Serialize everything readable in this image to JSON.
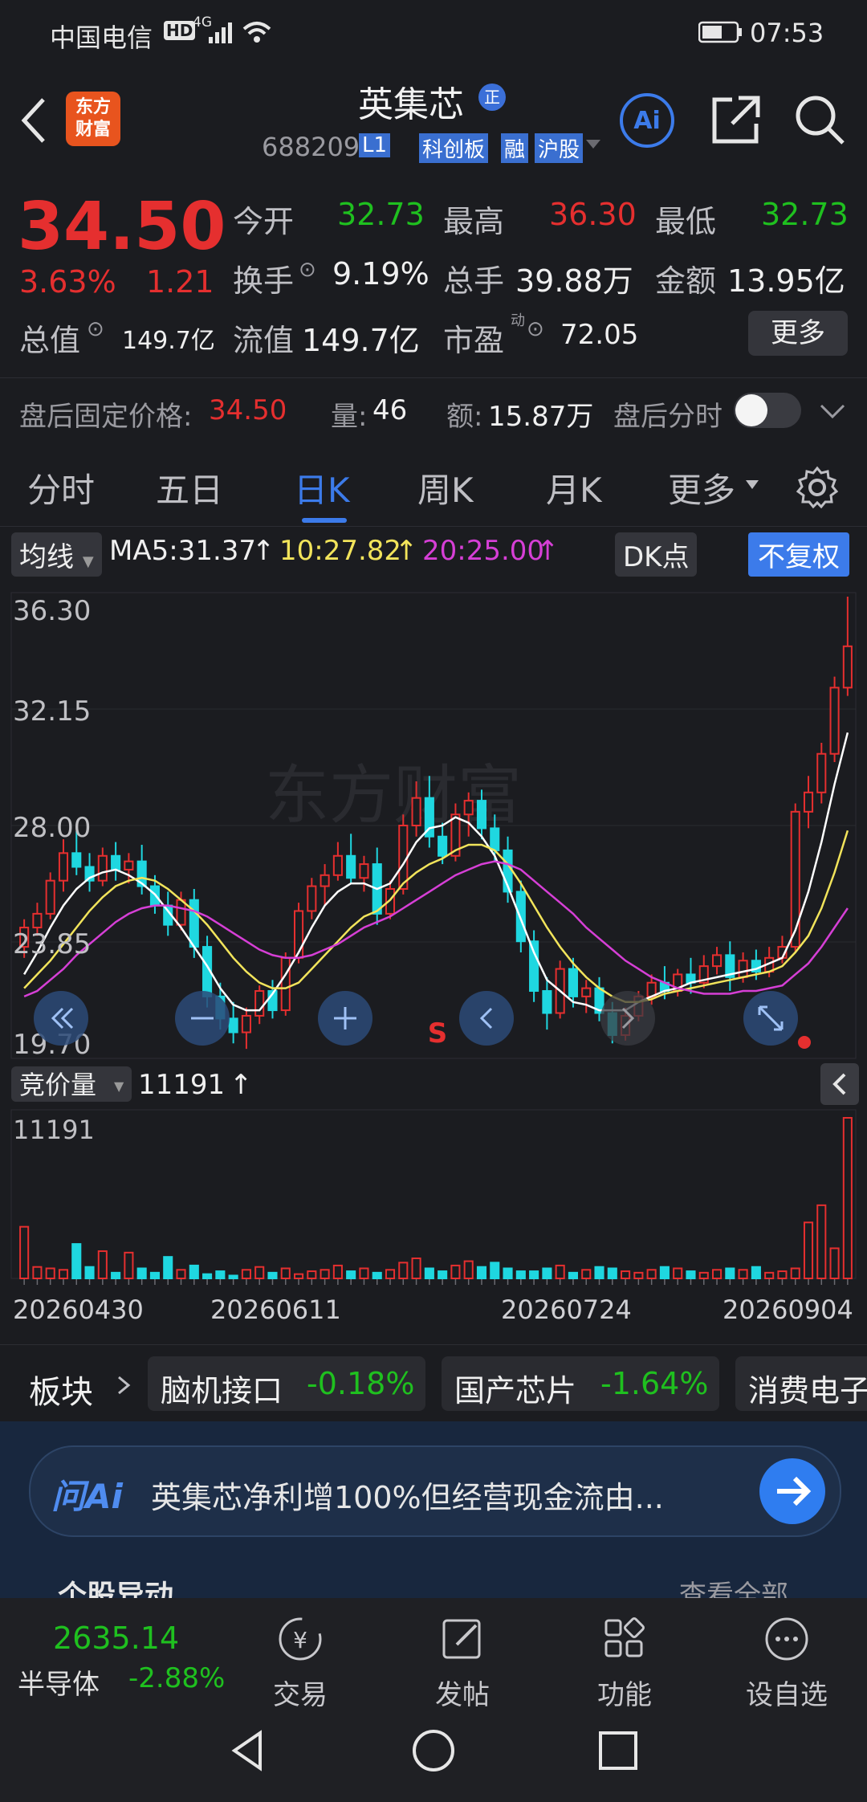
{
  "status_bar": {
    "carrier": "中国电信",
    "network": "4G",
    "hd": "HD",
    "time": "07:53"
  },
  "header": {
    "logo_line1": "东方",
    "logo_line2": "财富",
    "stock_name": "英集芯",
    "name_badge": "正",
    "code": "688209",
    "level_badge": "L1",
    "tags": [
      "科创板",
      "融",
      "沪股"
    ],
    "ai_label": "Ai"
  },
  "quote": {
    "price": "34.50",
    "change_pct": "3.63%",
    "change_amt": "1.21",
    "open_label": "今开",
    "open": "32.73",
    "high_label": "最高",
    "high": "36.30",
    "low_label": "最低",
    "low": "32.73",
    "turnover_label": "换手",
    "turnover": "9.19%",
    "volume_label": "总手",
    "volume": "39.88万",
    "amount_label": "金额",
    "amount": "13.95亿",
    "mcap_label": "总值",
    "mcap": "149.7亿",
    "float_label": "流值",
    "float_mcap": "149.7亿",
    "pe_label": "市盈",
    "pe_sup": "动",
    "pe": "72.05",
    "more_button": "更多"
  },
  "after_hours": {
    "label": "盘后固定价格:",
    "price": "34.50",
    "vol_label": "量:",
    "vol": "46",
    "amt_label": "额:",
    "amt": "15.87万",
    "chart_label": "盘后分时"
  },
  "tabs": [
    "分时",
    "五日",
    "日K",
    "周K",
    "月K",
    "更多"
  ],
  "active_tab": "日K",
  "ma_row": {
    "ma_toggle": "均线",
    "ma5": "MA5:31.37",
    "ma10": "10:27.82",
    "ma20": "20:25.00",
    "dk_button": "DK点",
    "fq_button": "不复权",
    "up_arrow": "↑"
  },
  "chart_data": {
    "type": "candlestick",
    "y_ticks": [
      "36.30",
      "32.15",
      "28.00",
      "23.85",
      "19.70"
    ],
    "ylim": [
      19.7,
      36.3
    ],
    "watermark": "东方财富",
    "sell_marker": "S",
    "candles": [
      [
        23.6,
        24.6,
        23.2,
        24.3
      ],
      [
        24.3,
        25.2,
        24.0,
        24.8
      ],
      [
        24.8,
        26.3,
        24.6,
        26.0
      ],
      [
        26.0,
        27.5,
        25.6,
        27.0
      ],
      [
        27.0,
        27.8,
        26.2,
        26.5
      ],
      [
        26.5,
        27.0,
        25.6,
        26.0
      ],
      [
        26.0,
        27.2,
        25.8,
        26.9
      ],
      [
        26.9,
        27.4,
        26.0,
        26.4
      ],
      [
        26.4,
        27.0,
        25.9,
        26.7
      ],
      [
        26.7,
        27.3,
        25.5,
        25.8
      ],
      [
        25.8,
        26.2,
        24.8,
        25.1
      ],
      [
        25.1,
        25.6,
        24.0,
        24.4
      ],
      [
        24.4,
        25.6,
        24.2,
        25.3
      ],
      [
        25.3,
        25.7,
        23.2,
        23.6
      ],
      [
        23.6,
        24.0,
        21.4,
        21.8
      ],
      [
        21.8,
        22.3,
        20.6,
        21.0
      ],
      [
        21.0,
        21.6,
        20.1,
        20.5
      ],
      [
        20.5,
        21.4,
        19.9,
        21.1
      ],
      [
        21.1,
        22.2,
        20.8,
        22.0
      ],
      [
        22.0,
        22.4,
        21.0,
        21.3
      ],
      [
        21.3,
        23.4,
        21.1,
        23.2
      ],
      [
        23.2,
        25.2,
        23.0,
        24.9
      ],
      [
        24.9,
        26.1,
        24.6,
        25.8
      ],
      [
        25.8,
        26.6,
        25.1,
        26.2
      ],
      [
        26.2,
        27.4,
        26.0,
        26.9
      ],
      [
        26.9,
        27.7,
        25.9,
        26.1
      ],
      [
        26.1,
        26.9,
        25.6,
        26.6
      ],
      [
        26.6,
        27.2,
        24.4,
        24.8
      ],
      [
        24.8,
        26.0,
        24.6,
        25.7
      ],
      [
        25.7,
        28.4,
        25.5,
        28.0
      ],
      [
        28.0,
        29.6,
        27.6,
        29.0
      ],
      [
        29.0,
        29.8,
        27.2,
        27.6
      ],
      [
        27.6,
        28.1,
        26.6,
        26.9
      ],
      [
        26.9,
        28.8,
        26.7,
        28.4
      ],
      [
        28.4,
        29.2,
        27.6,
        28.9
      ],
      [
        28.9,
        29.3,
        27.5,
        27.9
      ],
      [
        27.9,
        28.4,
        26.7,
        27.1
      ],
      [
        27.1,
        27.6,
        25.2,
        25.6
      ],
      [
        25.6,
        26.0,
        23.4,
        23.8
      ],
      [
        23.8,
        24.2,
        21.6,
        22.0
      ],
      [
        22.0,
        22.5,
        20.6,
        21.2
      ],
      [
        21.2,
        23.1,
        21.0,
        22.8
      ],
      [
        22.8,
        23.2,
        21.4,
        21.8
      ],
      [
        21.8,
        22.4,
        21.2,
        22.1
      ],
      [
        22.1,
        22.5,
        20.9,
        21.2
      ],
      [
        21.2,
        21.6,
        20.1,
        20.4
      ],
      [
        20.4,
        21.4,
        20.2,
        21.1
      ],
      [
        21.1,
        22.0,
        20.9,
        21.8
      ],
      [
        21.8,
        22.6,
        21.5,
        22.3
      ],
      [
        22.3,
        22.9,
        21.7,
        22.0
      ],
      [
        22.0,
        22.8,
        21.8,
        22.6
      ],
      [
        22.6,
        23.2,
        21.9,
        22.3
      ],
      [
        22.3,
        23.3,
        22.1,
        22.9
      ],
      [
        22.9,
        23.6,
        22.6,
        23.3
      ],
      [
        23.3,
        23.8,
        22.0,
        22.5
      ],
      [
        22.5,
        23.4,
        22.3,
        23.1
      ],
      [
        23.1,
        23.5,
        22.4,
        22.7
      ],
      [
        22.7,
        23.6,
        22.5,
        23.2
      ],
      [
        23.2,
        24.0,
        23.0,
        23.6
      ],
      [
        23.6,
        28.8,
        23.4,
        28.5
      ],
      [
        28.5,
        29.8,
        27.9,
        29.2
      ],
      [
        29.2,
        31.0,
        28.8,
        30.6
      ],
      [
        30.6,
        33.4,
        30.3,
        33.0
      ],
      [
        33.0,
        36.3,
        32.7,
        34.5
      ]
    ],
    "ma_series": [
      {
        "name": "MA5",
        "color": "#ffffff",
        "values": [
          22.6,
          23.4,
          24.3,
          25.1,
          25.7,
          26.1,
          26.3,
          26.4,
          26.2,
          25.9,
          25.5,
          24.9,
          24.3,
          23.6,
          22.9,
          22.1,
          21.5,
          21.3,
          21.3,
          21.9,
          22.6,
          23.4,
          24.3,
          25.1,
          25.6,
          25.9,
          25.9,
          25.7,
          25.9,
          26.6,
          27.4,
          27.9,
          28.0,
          28.3,
          28.1,
          27.6,
          26.9,
          25.8,
          24.6,
          23.4,
          22.4,
          22.0,
          21.6,
          21.5,
          21.3,
          21.3,
          21.3,
          21.6,
          21.8,
          22.0,
          22.1,
          22.3,
          22.4,
          22.5,
          22.6,
          22.7,
          22.8,
          23.0,
          23.2,
          24.2,
          25.6,
          27.4,
          29.5,
          31.37
        ]
      },
      {
        "name": "10",
        "color": "#f2e45b",
        "values": [
          22.1,
          22.6,
          23.1,
          23.7,
          24.3,
          24.9,
          25.4,
          25.8,
          26.0,
          26.1,
          26.0,
          25.7,
          25.3,
          24.9,
          24.4,
          23.8,
          23.2,
          22.7,
          22.3,
          22.1,
          22.1,
          22.3,
          22.8,
          23.3,
          23.8,
          24.3,
          24.7,
          24.9,
          25.3,
          25.9,
          26.3,
          26.6,
          26.8,
          27.1,
          27.3,
          27.3,
          27.1,
          26.6,
          25.9,
          25.1,
          24.3,
          23.6,
          23.0,
          22.5,
          22.1,
          21.8,
          21.6,
          21.6,
          21.7,
          21.9,
          22.0,
          22.1,
          22.2,
          22.3,
          22.4,
          22.5,
          22.6,
          22.7,
          22.9,
          23.4,
          24.0,
          25.0,
          26.3,
          27.82
        ]
      },
      {
        "name": "20",
        "color": "#d63fd6",
        "values": [
          21.8,
          22.0,
          22.4,
          22.8,
          23.3,
          23.7,
          24.1,
          24.5,
          24.8,
          25.0,
          25.1,
          25.1,
          25.0,
          24.9,
          24.7,
          24.4,
          24.1,
          23.8,
          23.5,
          23.3,
          23.2,
          23.2,
          23.3,
          23.5,
          23.7,
          24.0,
          24.3,
          24.5,
          24.7,
          25.0,
          25.3,
          25.6,
          25.9,
          26.2,
          26.4,
          26.6,
          26.7,
          26.6,
          26.4,
          26.0,
          25.6,
          25.2,
          24.8,
          24.3,
          23.9,
          23.5,
          23.1,
          22.8,
          22.5,
          22.3,
          22.1,
          22.0,
          21.9,
          21.9,
          21.9,
          22.0,
          22.0,
          22.1,
          22.2,
          22.6,
          23.0,
          23.6,
          24.3,
          25.0
        ]
      }
    ],
    "volume_label": "竞价量",
    "volume_value": "11191",
    "volume_ylim": [
      0,
      11191
    ],
    "volume_tick": "11191",
    "volumes": [
      3600,
      800,
      700,
      600,
      2400,
      800,
      1900,
      400,
      1800,
      700,
      400,
      1500,
      600,
      900,
      300,
      500,
      200,
      600,
      800,
      400,
      700,
      300,
      500,
      600,
      900,
      500,
      700,
      400,
      600,
      1100,
      1400,
      700,
      500,
      900,
      1200,
      800,
      1100,
      700,
      500,
      500,
      700,
      900,
      400,
      600,
      800,
      700,
      500,
      400,
      600,
      800,
      700,
      500,
      400,
      600,
      700,
      600,
      800,
      400,
      500,
      700,
      3900,
      5100,
      2100,
      11191
    ],
    "x_ticks": [
      "20260430",
      "20260611",
      "20260724",
      "20260904"
    ]
  },
  "sectors": {
    "label": "板块",
    "items": [
      {
        "name": "脑机接口",
        "pct": "-0.18%"
      },
      {
        "name": "国产芯片",
        "pct": "-1.64%"
      },
      {
        "name": "消费电子",
        "pct": ""
      }
    ]
  },
  "ask_ai": {
    "logo": "问Ai",
    "text": "英集芯净利增100%但经营现金流由..."
  },
  "bottom_nav": {
    "index_value": "2635.14",
    "index_name": "半导体",
    "index_pct": "-2.88%",
    "items": [
      "交易",
      "发帖",
      "功能",
      "设自选"
    ]
  },
  "partial_section": {
    "left": "个股异动",
    "right": "查看全部"
  }
}
